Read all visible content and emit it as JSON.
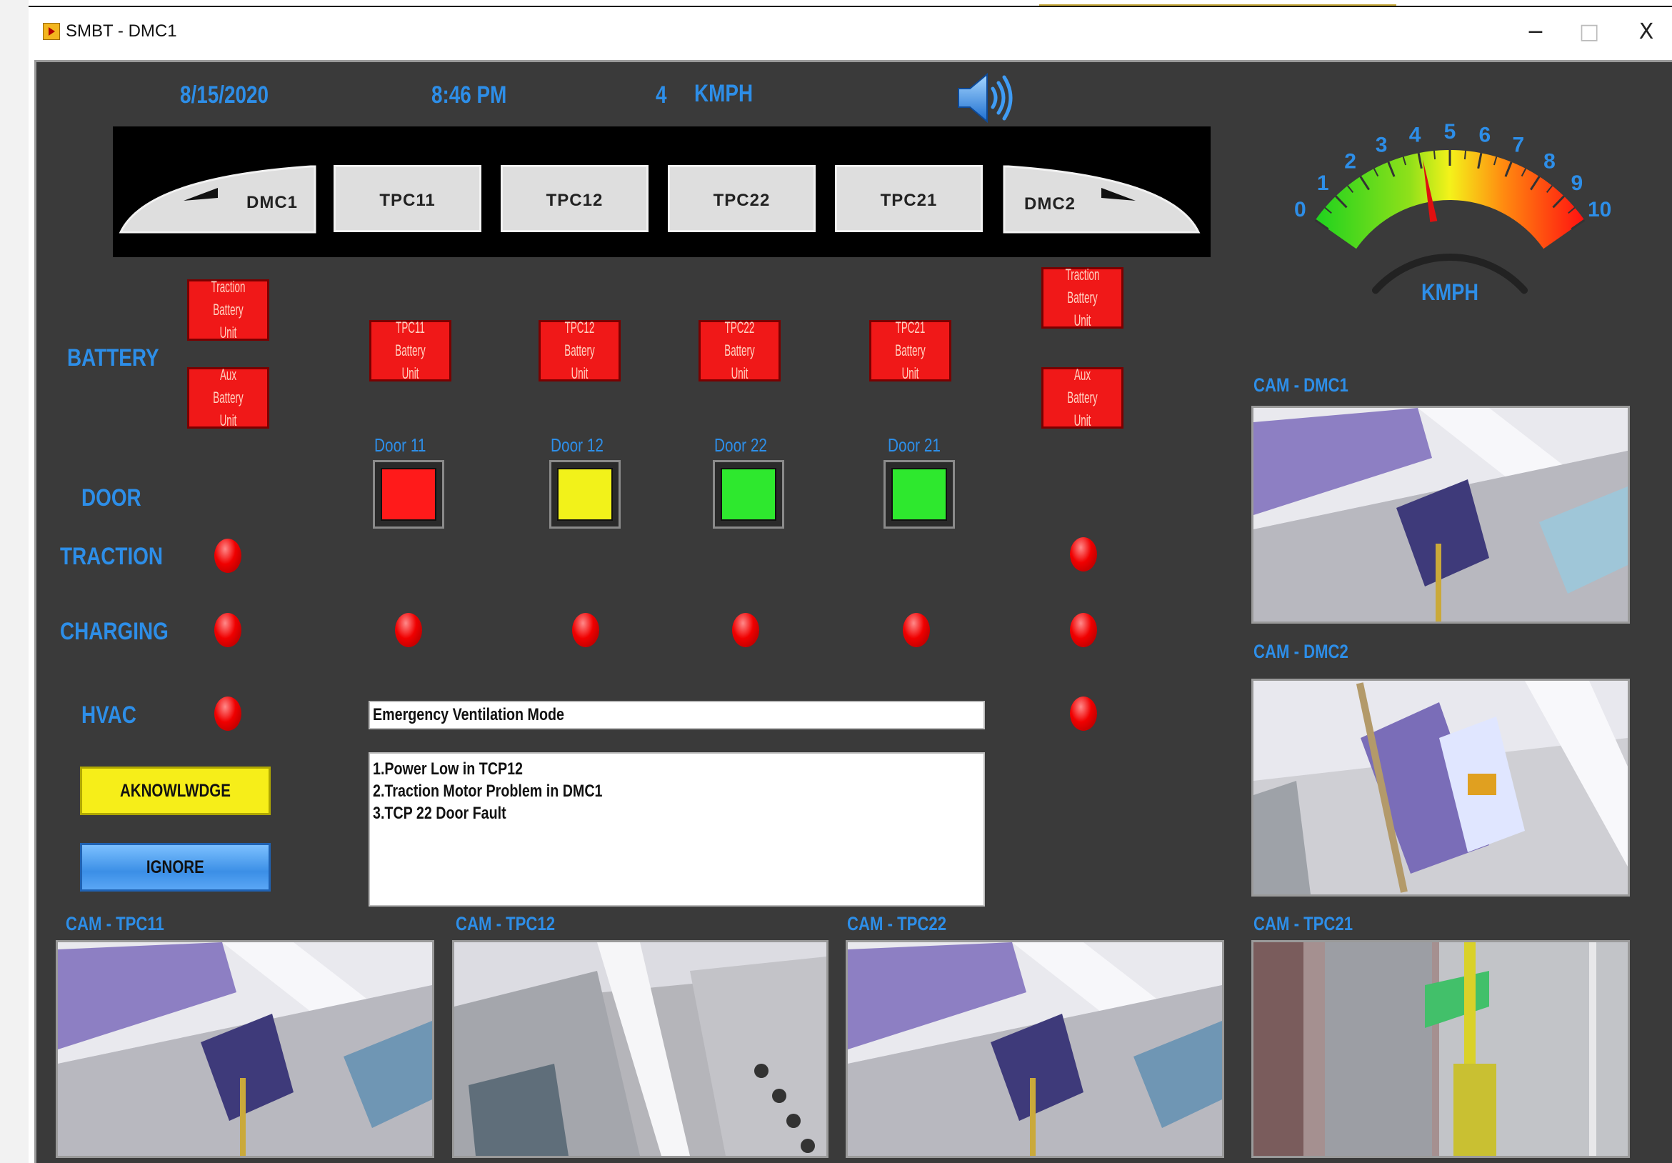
{
  "window": {
    "title": "SMBT - DMC1",
    "minimize_label": "−",
    "maximize_label": "□",
    "close_label": "X"
  },
  "header": {
    "date": "8/15/2020",
    "time": "8:46 PM",
    "speed_value": "4",
    "speed_unit": "KMPH"
  },
  "cars": [
    "DMC1",
    "TPC11",
    "TPC12",
    "TPC22",
    "TPC21",
    "DMC2"
  ],
  "row_labels": {
    "battery": "BATTERY",
    "door": "DOOR",
    "traction": "TRACTION",
    "charging": "CHARGING",
    "hvac": "HVAC"
  },
  "battery_units": {
    "dmc1_traction": [
      "Traction",
      "Battery Unit"
    ],
    "dmc1_aux": [
      "Aux",
      "Battery Unit"
    ],
    "tpc11": [
      "TPC11",
      "Battery Unit"
    ],
    "tpc12": [
      "TPC12",
      "Battery Unit"
    ],
    "tpc22": [
      "TPC22",
      "Battery Unit"
    ],
    "tpc21": [
      "TPC21",
      "Battery Unit"
    ],
    "dmc2_traction": [
      "Traction",
      "Battery Unit"
    ],
    "dmc2_aux": [
      "Aux",
      "Battery Unit"
    ]
  },
  "doors": [
    {
      "label": "Door 11",
      "status_color": "#ff1a1a"
    },
    {
      "label": "Door 12",
      "status_color": "#f2f21a"
    },
    {
      "label": "Door 22",
      "status_color": "#2ee82e"
    },
    {
      "label": "Door 21",
      "status_color": "#2ee82e"
    }
  ],
  "indicator_color": "#ff0000",
  "messages": {
    "mode": "Emergency Ventilation Mode",
    "alarms": [
      "1.Power Low in TCP12",
      "2.Traction Motor Problem in DMC1",
      "3.TCP 22 Door Fault"
    ]
  },
  "actions": {
    "acknowledge_label": "AKNOWLWDGE",
    "ignore_label": "IGNORE"
  },
  "gauge": {
    "unit": "KMPH",
    "min": 0,
    "max": 10,
    "ticks": [
      "0",
      "1",
      "2",
      "3",
      "4",
      "5",
      "6",
      "7",
      "8",
      "9",
      "10"
    ],
    "value": 4.1
  },
  "cameras": {
    "dmc1": "CAM - DMC1",
    "dmc2": "CAM - DMC2",
    "tpc11": "CAM - TPC11",
    "tpc12": "CAM - TPC12",
    "tpc22": "CAM - TPC22",
    "tpc21": "CAM - TPC21"
  },
  "icons": {
    "app": "app-icon",
    "sound": "speaker-volume-icon"
  },
  "colors": {
    "panel_bg": "#3a3a3a",
    "label_blue": "#2d8ee8",
    "battery_red": "#f01818",
    "ack_yellow": "#f6ee19",
    "ignore_blue": "#3b8fe6"
  }
}
